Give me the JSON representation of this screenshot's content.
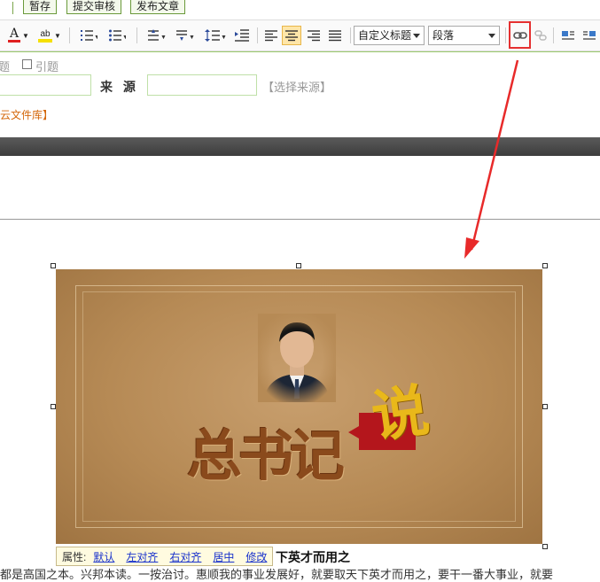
{
  "top_buttons": {
    "save_draft": "暂存",
    "submit_review": "提交审核",
    "publish": "发布文章"
  },
  "toolbar": {
    "heading_select": "自定义标题",
    "paragraph_select": "段落",
    "font_color": "A",
    "highlight": "ab"
  },
  "form": {
    "partial_label": "题",
    "quote_checkbox": "引题",
    "source_label": "来 源",
    "choose_source": "【选择来源】",
    "cloud_library": "云文件库】"
  },
  "content": {
    "image_title": "总书记",
    "image_badge": "说",
    "heading_tail": "下英才而用之",
    "body_line": "都是高国之本。兴邦本读。一按治讨。惠顺我的事业发展好，就要取天下英才而用之，要干一番大事业，就要"
  },
  "image_toolbar": {
    "label": "属性:",
    "default": "默认",
    "align_left": "左对齐",
    "align_right": "右对齐",
    "center": "居中",
    "modify": "修改"
  },
  "colors": {
    "highlight_border": "#e53030",
    "accent_green": "#6a9a3a",
    "link": "#1a33cc"
  }
}
